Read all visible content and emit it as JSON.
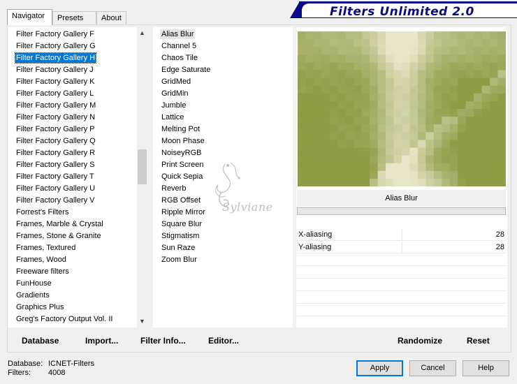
{
  "tabs": [
    {
      "label": "Navigator",
      "active": true
    },
    {
      "label": "Presets",
      "active": false
    },
    {
      "label": "About",
      "active": false
    }
  ],
  "banner": {
    "title": "Filters Unlimited 2.0"
  },
  "categories": {
    "items": [
      "Filter Factory Gallery F",
      "Filter Factory Gallery G",
      "Filter Factory Gallery H",
      "Filter Factory Gallery J",
      "Filter Factory Gallery K",
      "Filter Factory Gallery L",
      "Filter Factory Gallery M",
      "Filter Factory Gallery N",
      "Filter Factory Gallery P",
      "Filter Factory Gallery Q",
      "Filter Factory Gallery R",
      "Filter Factory Gallery S",
      "Filter Factory Gallery T",
      "Filter Factory Gallery U",
      "Filter Factory Gallery V",
      "Forrest's Filters",
      "Frames, Marble & Crystal",
      "Frames, Stone & Granite",
      "Frames, Textured",
      "Frames, Wood",
      "Freeware filters",
      "FunHouse",
      "Gradients",
      "Graphics Plus",
      "Greg's Factory Output Vol. II"
    ],
    "selected": "Filter Factory Gallery H"
  },
  "filters": {
    "items": [
      "Alias Blur",
      "Channel 5",
      "Chaos Tile",
      "Edge Saturate",
      "GridMed",
      "GridMin",
      "Jumble",
      "Lattice",
      "Melting Pot",
      "Moon Phase",
      "NoiseyRGB",
      "Print Screen",
      "Quick Sepia",
      "Reverb",
      "RGB Offset",
      "Ripple Mirror",
      "Square Blur",
      "Stigmatism",
      "Sun Raze",
      "Zoom Blur"
    ],
    "selected": "Alias Blur"
  },
  "preview": {
    "filter_name": "Alias Blur"
  },
  "parameters": [
    {
      "label": "X-aliasing",
      "value": "28"
    },
    {
      "label": "Y-aliasing",
      "value": "28"
    }
  ],
  "watermark": {
    "text": "Sylviane"
  },
  "toolbar": {
    "database": "Database",
    "import": "Import...",
    "filter_info": "Filter Info...",
    "editor": "Editor...",
    "randomize": "Randomize",
    "reset": "Reset"
  },
  "status": {
    "database_label": "Database:",
    "database_value": "ICNET-Filters",
    "filters_label": "Filters:",
    "filters_value": "4008"
  },
  "buttons": {
    "apply": "Apply",
    "cancel": "Cancel",
    "help": "Help"
  },
  "colors": {
    "accent": "#0078d7",
    "banner": "#0a0a86",
    "preview_base": "#b8bf72"
  }
}
